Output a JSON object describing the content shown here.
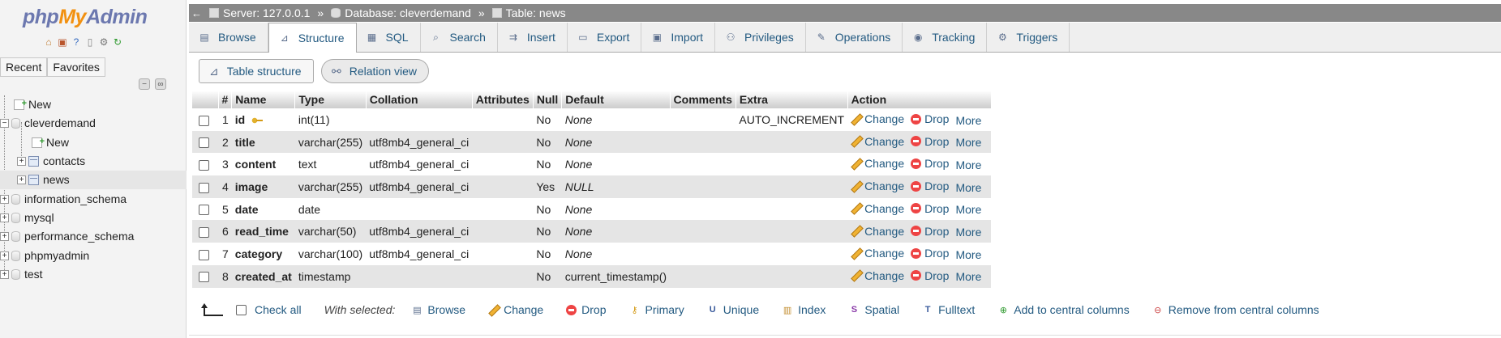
{
  "nav": {
    "logo_php": "php",
    "logo_my": "My",
    "logo_admin": "Admin",
    "icons": [
      "home-icon",
      "exit-icon",
      "help-icon",
      "docs-icon",
      "settings-icon",
      "reload-icon"
    ],
    "tab_recent": "Recent",
    "tab_favorites": "Favorites",
    "tree": {
      "new": "New",
      "cleverdemand": "cleverdemand",
      "cleverdemand_new": "New",
      "contacts": "contacts",
      "news": "news",
      "information_schema": "information_schema",
      "mysql": "mysql",
      "performance_schema": "performance_schema",
      "phpmyadmin": "phpmyadmin",
      "test": "test"
    }
  },
  "breadcrumb": {
    "server": "Server: 127.0.0.1",
    "database": "Database: cleverdemand",
    "table": "Table: news",
    "separator": "»"
  },
  "tabs": {
    "browse": "Browse",
    "structure": "Structure",
    "sql": "SQL",
    "search": "Search",
    "insert": "Insert",
    "export": "Export",
    "import": "Import",
    "privileges": "Privileges",
    "operations": "Operations",
    "tracking": "Tracking",
    "triggers": "Triggers"
  },
  "subtabs": {
    "table_structure": "Table structure",
    "relation_view": "Relation view"
  },
  "columns": {
    "num": "#",
    "name": "Name",
    "type": "Type",
    "collation": "Collation",
    "attributes": "Attributes",
    "null": "Null",
    "default": "Default",
    "comments": "Comments",
    "extra": "Extra",
    "action": "Action"
  },
  "rows": [
    {
      "num": "1",
      "name": "id",
      "type": "int(11)",
      "collation": "",
      "attributes": "",
      "null": "No",
      "default": "None",
      "comments": "",
      "extra": "AUTO_INCREMENT"
    },
    {
      "num": "2",
      "name": "title",
      "type": "varchar(255)",
      "collation": "utf8mb4_general_ci",
      "attributes": "",
      "null": "No",
      "default": "None",
      "comments": "",
      "extra": ""
    },
    {
      "num": "3",
      "name": "content",
      "type": "text",
      "collation": "utf8mb4_general_ci",
      "attributes": "",
      "null": "No",
      "default": "None",
      "comments": "",
      "extra": ""
    },
    {
      "num": "4",
      "name": "image",
      "type": "varchar(255)",
      "collation": "utf8mb4_general_ci",
      "attributes": "",
      "null": "Yes",
      "default": "NULL",
      "comments": "",
      "extra": ""
    },
    {
      "num": "5",
      "name": "date",
      "type": "date",
      "collation": "",
      "attributes": "",
      "null": "No",
      "default": "None",
      "comments": "",
      "extra": ""
    },
    {
      "num": "6",
      "name": "read_time",
      "type": "varchar(50)",
      "collation": "utf8mb4_general_ci",
      "attributes": "",
      "null": "No",
      "default": "None",
      "comments": "",
      "extra": ""
    },
    {
      "num": "7",
      "name": "category",
      "type": "varchar(100)",
      "collation": "utf8mb4_general_ci",
      "attributes": "",
      "null": "No",
      "default": "None",
      "comments": "",
      "extra": ""
    },
    {
      "num": "8",
      "name": "created_at",
      "type": "timestamp",
      "collation": "",
      "attributes": "",
      "null": "No",
      "default": "current_timestamp()",
      "comments": "",
      "extra": ""
    }
  ],
  "actions": {
    "change": "Change",
    "drop": "Drop",
    "more": "More"
  },
  "footer": {
    "check_all": "Check all",
    "with_selected": "With selected:",
    "browse": "Browse",
    "change": "Change",
    "drop": "Drop",
    "primary": "Primary",
    "unique": "Unique",
    "index": "Index",
    "spatial": "Spatial",
    "fulltext": "Fulltext",
    "add_central": "Add to central columns",
    "remove_central": "Remove from central columns"
  },
  "colors": {
    "link": "#235a81",
    "breadcrumb_bg": "#888888",
    "row_alt": "#e5e5e5",
    "logo_blue": "#6c78af",
    "logo_orange": "#f29111"
  }
}
